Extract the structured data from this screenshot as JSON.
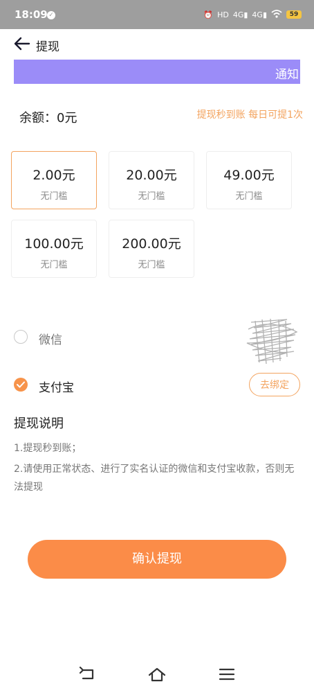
{
  "status_bar": {
    "time": "18:09",
    "battery": "59",
    "icons": [
      "alarm-icon",
      "hd-icon",
      "signal-4g-icon",
      "signal-4g-icon",
      "wifi-icon",
      "battery-icon"
    ]
  },
  "header": {
    "title": "提现",
    "back_icon": "arrow-left-icon"
  },
  "notice": {
    "text": "通知"
  },
  "balance": {
    "label": "余额：0元",
    "promo": "提现秒到账 每日可提1次"
  },
  "amounts": [
    {
      "value": "2.00元",
      "note": "无门槛",
      "selected": true
    },
    {
      "value": "20.00元",
      "note": "无门槛",
      "selected": false
    },
    {
      "value": "49.00元",
      "note": "无门槛",
      "selected": false
    },
    {
      "value": "100.00元",
      "note": "无门槛",
      "selected": false
    },
    {
      "value": "200.00元",
      "note": "无门槛",
      "selected": false
    }
  ],
  "payment": {
    "wechat_label": "微信",
    "alipay_label": "支付宝",
    "unbind_label": "去绑定",
    "selected": "alipay"
  },
  "instructions": {
    "title": "提现说明",
    "line1": "1.提现秒到账；",
    "line2": "2.请使用正常状态、进行了实名认证的微信和支付宝收款，否则无法提现"
  },
  "confirm_label": "确认提现",
  "nav": {
    "icons": [
      "back-nav-icon",
      "home-icon",
      "menu-icon"
    ]
  },
  "colors": {
    "accent": "#fb8c48",
    "notice_bg": "#9b8cf8",
    "promo": "#f3a35e"
  }
}
